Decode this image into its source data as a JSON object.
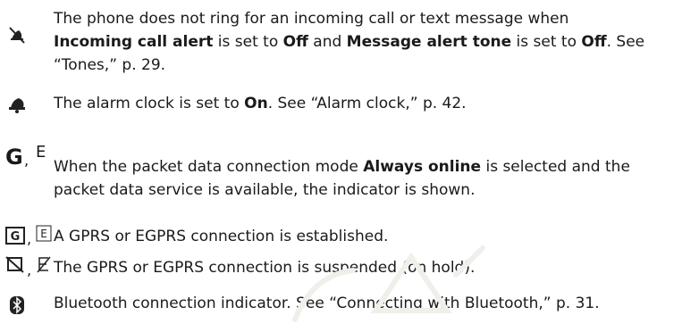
{
  "entries": [
    {
      "icon": "silent-bell-icon",
      "t1": "The phone does not ring for an incoming call or text message when",
      "b1": "Incoming call alert",
      "t2": " is set to ",
      "b2": "Off",
      "t3": " and ",
      "b3": "Message alert tone",
      "t4": " is set to ",
      "b4": "Off",
      "t5": ". See “Tones,” p. 29."
    },
    {
      "icon": "alarm-bell-icon",
      "t1": "The alarm clock is set to ",
      "b1": "On",
      "t2": ". See “Alarm clock,” p. 42."
    },
    {
      "icons": [
        "G",
        ",",
        "E"
      ],
      "t1": "When the packet data connection mode ",
      "b1": "Always online",
      "t2": " is selected and the packet data service is available, the indicator is shown."
    },
    {
      "icons": [
        "G",
        ",",
        "E"
      ],
      "text": "A GPRS or EGPRS connection is established."
    },
    {
      "icons": [
        "suspended-gprs-icon",
        ",",
        "suspended-egprs-icon"
      ],
      "text": "The GPRS or EGPRS connection is suspended (on hold)."
    },
    {
      "icon": "bluetooth-icon",
      "text": "Bluetooth connection indicator. See “Connecting with Bluetooth,” p. 31."
    }
  ]
}
